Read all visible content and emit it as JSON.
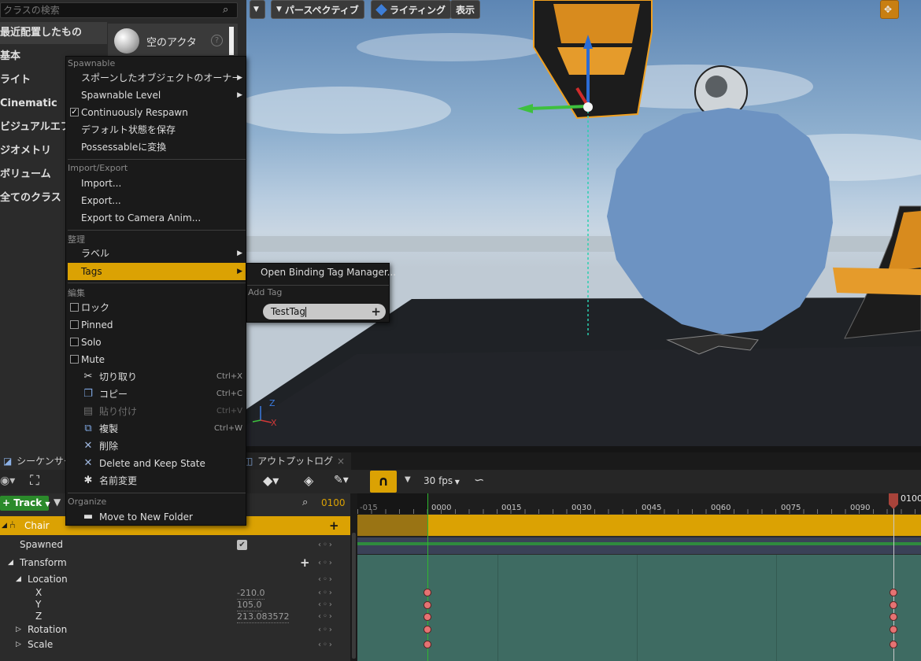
{
  "place_panel": {
    "search_placeholder": "クラスの検索",
    "categories": [
      "最近配置したもの",
      "基本",
      "ライト",
      "Cinematic",
      "ビジュアルエフ",
      "ジオメトリ",
      "ボリューム",
      "全てのクラス"
    ],
    "actor_item_label": "空のアクタ"
  },
  "viewport": {
    "perspective_label": "パースペクティブ",
    "lighting_label": "ライティング",
    "show_label": "表示"
  },
  "context_menu": {
    "section_spawnable": "Spawnable",
    "spawned_owner": "スポーンしたオブジェクトのオーナー",
    "spawnable_level": "Spawnable Level",
    "continuously_respawn": "Continuously Respawn",
    "save_default_state": "デフォルト状態を保存",
    "convert_possessable": "Possessableに変換",
    "section_import_export": "Import/Export",
    "import": "Import...",
    "export": "Export...",
    "export_camera_anim": "Export to Camera Anim...",
    "section_organize_jp": "整理",
    "label": "ラベル",
    "tags": "Tags",
    "section_edit": "編集",
    "lock": "ロック",
    "pinned": "Pinned",
    "solo": "Solo",
    "mute": "Mute",
    "cut": "切り取り",
    "cut_shortcut": "Ctrl+X",
    "copy": "コピー",
    "copy_shortcut": "Ctrl+C",
    "paste": "貼り付け",
    "paste_shortcut": "Ctrl+V",
    "duplicate": "複製",
    "duplicate_shortcut": "Ctrl+W",
    "delete": "削除",
    "delete_keep_state": "Delete and Keep State",
    "rename": "名前変更",
    "section_organize": "Organize",
    "move_new_folder": "Move to New Folder"
  },
  "tags_submenu": {
    "open_manager": "Open Binding Tag Manager...",
    "add_tag_label": "Add Tag",
    "tag_input_value": "TestTag"
  },
  "tabs": {
    "sequencer": "シーケンサー",
    "output_log": "アウトプットログ"
  },
  "toolbar": {
    "fps": "30 fps"
  },
  "tracks": {
    "add_track": "Track",
    "current_frame": "0100",
    "actor_name": "Chair",
    "spawned": "Spawned",
    "transform": "Transform",
    "location": "Location",
    "x_label": "X",
    "x_value": "-210.0",
    "y_label": "Y",
    "y_value": "105.0",
    "z_label": "Z",
    "z_value": "213.083572",
    "rotation": "Rotation",
    "scale": "Scale"
  },
  "timeline": {
    "ticks": [
      "-015",
      "0000",
      "0015",
      "0030",
      "0045",
      "0060",
      "0075",
      "0090"
    ],
    "playhead_label": "0100"
  },
  "colors": {
    "accent": "#dba203",
    "track_bg": "#3e6b62",
    "key_color": "#e57373"
  }
}
